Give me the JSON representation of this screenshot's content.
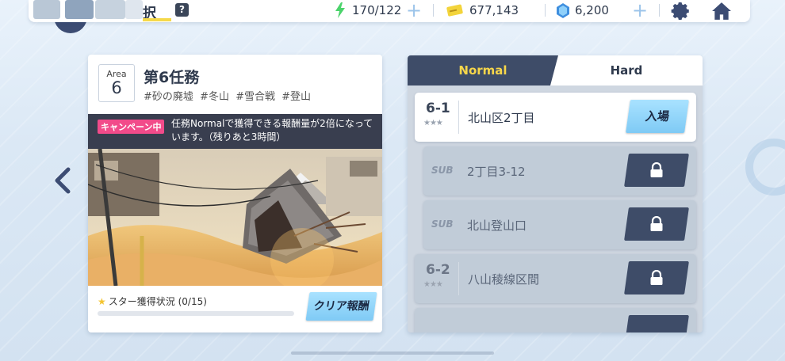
{
  "header": {
    "title_fragment": "択",
    "help_icon": "?",
    "stamina": "170/122",
    "credits": "677,143",
    "gems": "6,200",
    "icons": [
      "lightning-icon",
      "credit-card-icon",
      "gem-icon",
      "gear-icon",
      "home-icon"
    ]
  },
  "mission": {
    "area_label": "Area",
    "area_number": "6",
    "title": "第6任務",
    "tags": [
      "#砂の廃墟",
      "#冬山",
      "#雪合戦",
      "#登山"
    ],
    "campaign_badge": "キャンペーン中",
    "campaign_text": "任務Normalで獲得できる報酬量が2倍になっています。（残りあと3時間）",
    "star_status": "スター獲得状況 (0/15)",
    "star_progress": 0,
    "clear_reward_label": "クリア報酬"
  },
  "difficulty_tabs": {
    "normal": "Normal",
    "hard": "Hard",
    "active": "Normal"
  },
  "stages": [
    {
      "id": "6-1",
      "name": "北山区2丁目",
      "action": "入場",
      "locked": false,
      "stars": "★★★"
    },
    {
      "sub_tag": "SUB",
      "name": "2丁目3-12",
      "locked": true
    },
    {
      "sub_tag": "SUB",
      "name": "北山登山口",
      "locked": true
    },
    {
      "id": "6-2",
      "name": "八山稜線区間",
      "locked": true,
      "stars": "★★★"
    }
  ],
  "colors": {
    "accent_yellow": "#f7d64a",
    "tab_dark": "#3e4c68",
    "button_blue": "#8fd3f8",
    "campaign_pink": "#f24b8a"
  }
}
